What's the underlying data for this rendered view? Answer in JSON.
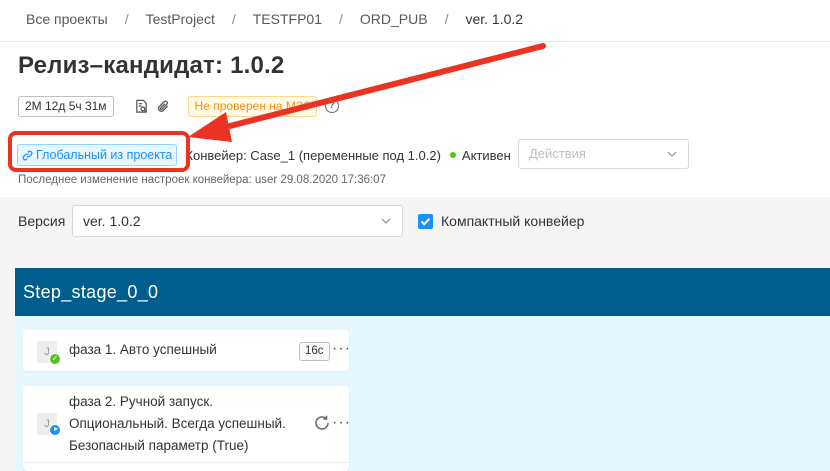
{
  "breadcrumb": {
    "items": [
      "Все проекты",
      "TestProject",
      "TESTFP01",
      "ORD_PUB",
      "ver. 1.0.2"
    ],
    "separator": "/"
  },
  "page": {
    "title": "Релиз–кандидат: 1.0.2"
  },
  "meta": {
    "duration": "2М 12д 5ч 31м",
    "warning": "Не проверен на МЗ6",
    "help": "?"
  },
  "pipeline": {
    "global_tag": "Глобальный из проекта",
    "info": "Конвейер: Case_1 (переменные под 1.0.2)",
    "status": "Активен",
    "status_color": "#52c41a",
    "actions_placeholder": "Действия",
    "last_change": "Последнее изменение настроек конвейера: user 29.08.2020 17:36:07"
  },
  "version_bar": {
    "label": "Версия",
    "selected": "ver. 1.0.2",
    "compact_label": "Компактный конвейер",
    "compact_checked": true
  },
  "stage": {
    "title": "Step_stage_0_0",
    "header_color": "#005e8f",
    "phases": [
      {
        "avatar": "J",
        "name": "фаза 1. Авто успешный",
        "time": "16с",
        "status_icon": "check-icon"
      },
      {
        "avatar": "J",
        "name_lines": [
          "фаза 2. Ручной запуск.",
          "Опциональный. Всегда успешный.",
          "Безопасный параметр (True)"
        ],
        "status_icon": "play-icon"
      }
    ]
  },
  "annotation": {
    "color": "#ea3323"
  }
}
